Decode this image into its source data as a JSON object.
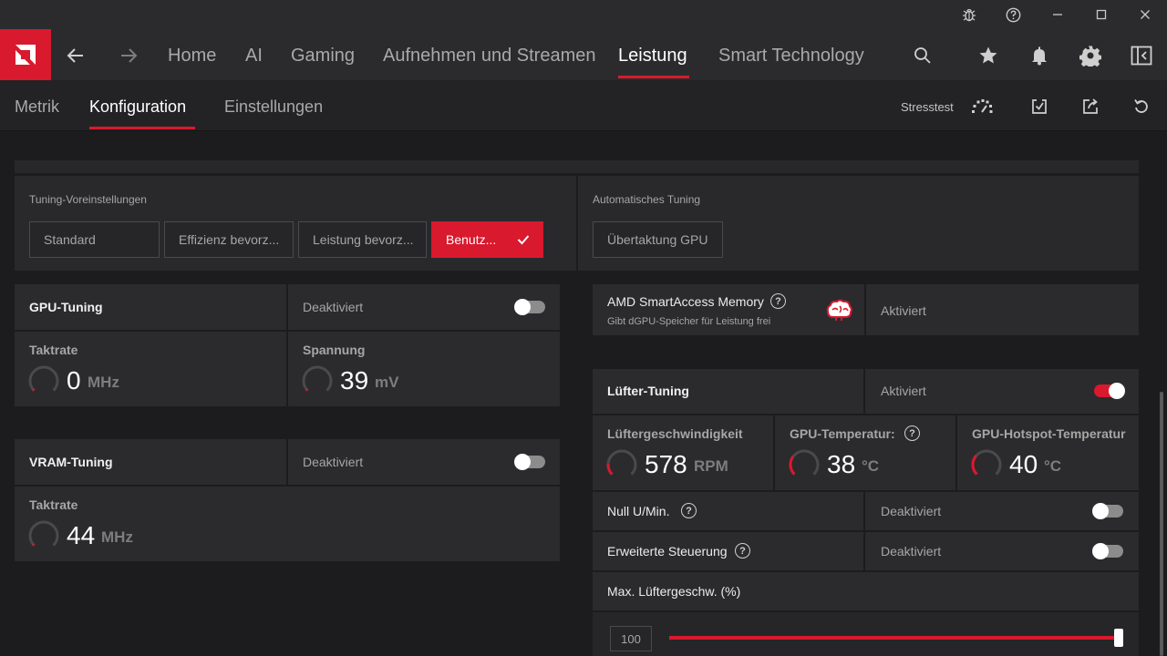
{
  "nav": {
    "tabs": [
      {
        "label": "Home"
      },
      {
        "label": "AI"
      },
      {
        "label": "Gaming"
      },
      {
        "label": "Aufnehmen und Streamen"
      },
      {
        "label": "Leistung",
        "active": true
      },
      {
        "label": "Smart Technology"
      }
    ]
  },
  "subnav": {
    "tabs": [
      {
        "label": "Metrik"
      },
      {
        "label": "Konfiguration",
        "active": true
      },
      {
        "label": "Einstellungen"
      }
    ],
    "stresstest_label": "Stresstest"
  },
  "presets": {
    "title": "Tuning-Voreinstellungen",
    "buttons": [
      "Standard",
      "Effizienz bevorz...",
      "Leistung bevorz...",
      "Benutz..."
    ],
    "active_index": 3
  },
  "auto_tuning": {
    "title": "Automatisches Tuning",
    "button": "Übertaktung GPU"
  },
  "gpu_tuning": {
    "title": "GPU-Tuning",
    "status": "Deaktiviert",
    "enabled": false,
    "clock": {
      "label": "Taktrate",
      "value": "0",
      "unit": "MHz",
      "level": 0.0
    },
    "voltage": {
      "label": "Spannung",
      "value": "39",
      "unit": "mV",
      "level": 0.02
    }
  },
  "vram_tuning": {
    "title": "VRAM-Tuning",
    "status": "Deaktiviert",
    "enabled": false,
    "clock": {
      "label": "Taktrate",
      "value": "44",
      "unit": "MHz",
      "level": 0.01
    }
  },
  "sam": {
    "title": "AMD SmartAccess Memory",
    "subtitle": "Gibt dGPU-Speicher für Leistung frei",
    "status": "Aktiviert"
  },
  "fan_tuning": {
    "title": "Lüfter-Tuning",
    "status": "Aktiviert",
    "enabled": true,
    "speed": {
      "label": "Lüftergeschwindigkeit",
      "value": "578",
      "unit": "RPM",
      "level": 0.18
    },
    "gpu_temp": {
      "label": "GPU-Temperatur:",
      "value": "38",
      "unit": "°C",
      "level": 0.3
    },
    "hotspot_temp": {
      "label": "GPU-Hotspot-Temperatur",
      "value": "40",
      "unit": "°C",
      "level": 0.32
    },
    "zero_rpm": {
      "label": "Null U/Min.",
      "status": "Deaktiviert",
      "enabled": false
    },
    "advanced": {
      "label": "Erweiterte Steuerung",
      "status": "Deaktiviert",
      "enabled": false
    },
    "max_speed": {
      "label": "Max. Lüftergeschw. (%)",
      "value": "100",
      "level": 1.0
    }
  },
  "colors": {
    "accent": "#d9192e",
    "background": "#1c1c1e",
    "panel": "#2b2b2d"
  }
}
